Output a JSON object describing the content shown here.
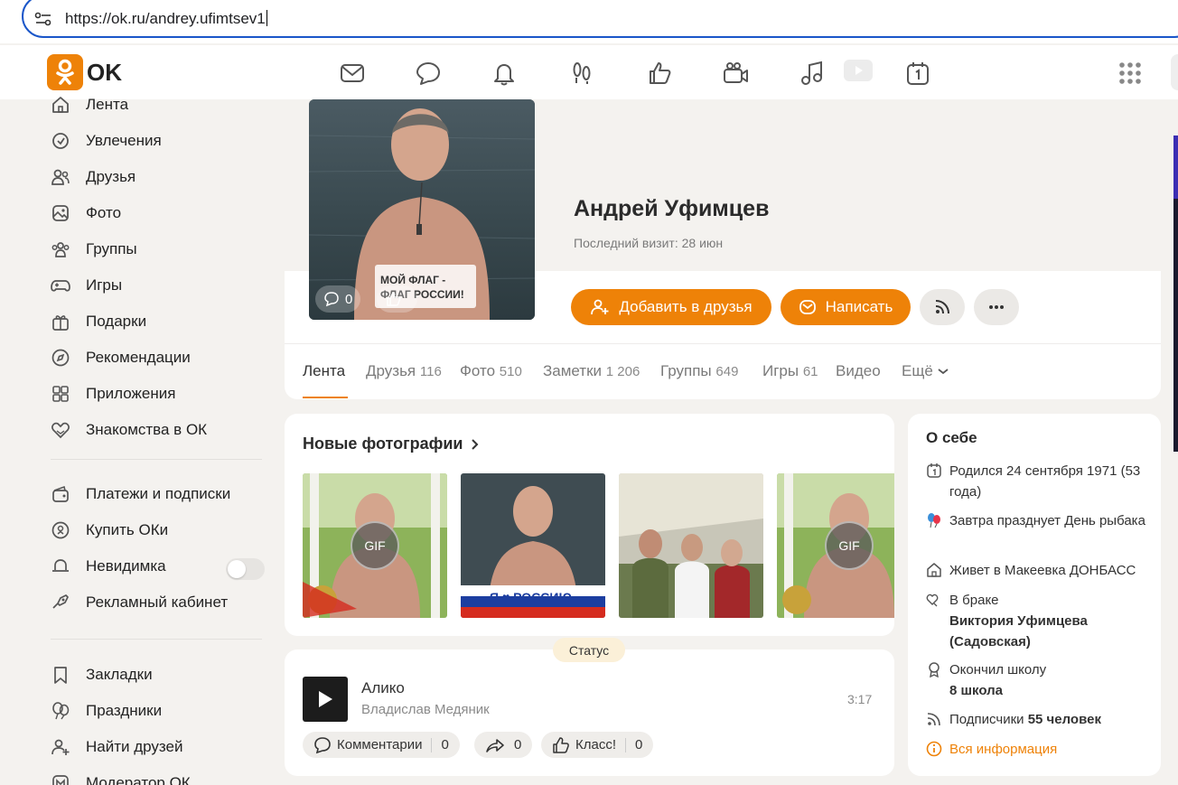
{
  "browser": {
    "url": "https://ok.ru/andrey.ufimtsev1"
  },
  "brand": {
    "logo_text": "OK",
    "accent": "#ee8208"
  },
  "topnav": {
    "icons": [
      "messages-icon",
      "discussions-icon",
      "notifications-icon",
      "guests-icon",
      "likes-icon",
      "friends-video-icon",
      "music-icon",
      "video-icon",
      "events-icon",
      "apps-grid-icon"
    ]
  },
  "sidebar": {
    "items": [
      {
        "label": "Лента",
        "icon": "home-icon"
      },
      {
        "label": "Увлечения",
        "icon": "hobby-icon"
      },
      {
        "label": "Друзья",
        "icon": "friends-icon"
      },
      {
        "label": "Фото",
        "icon": "photo-icon"
      },
      {
        "label": "Группы",
        "icon": "groups-icon"
      },
      {
        "label": "Игры",
        "icon": "gamepad-icon"
      },
      {
        "label": "Подарки",
        "icon": "gift-icon"
      },
      {
        "label": "Рекомендации",
        "icon": "compass-icon"
      },
      {
        "label": "Приложения",
        "icon": "apps-icon"
      },
      {
        "label": "Знакомства в ОК",
        "icon": "dating-icon"
      }
    ],
    "items2": [
      {
        "label": "Платежи и подписки",
        "icon": "wallet-icon"
      },
      {
        "label": "Купить ОКи",
        "icon": "coin-icon"
      },
      {
        "label": "Невидимка",
        "icon": "invisible-icon"
      },
      {
        "label": "Рекламный кабинет",
        "icon": "megaphone-icon"
      }
    ],
    "items3": [
      {
        "label": "Закладки",
        "icon": "bookmark-icon"
      },
      {
        "label": "Праздники",
        "icon": "balloons-icon"
      },
      {
        "label": "Найти друзей",
        "icon": "add-friend-icon"
      },
      {
        "label": "Модератор ОК",
        "icon": "moderator-icon"
      }
    ]
  },
  "profile": {
    "name": "Андрей Уфимцев",
    "last_visit": "Последний визит: 28 июн",
    "avatar_caption": "МОЙ ФЛАГ - ФЛАГ РОССИИ!",
    "avatar_comments": "0",
    "add_friend_label": "Добавить в друзья",
    "message_label": "Написать"
  },
  "tabs": [
    {
      "label": "Лента",
      "count": ""
    },
    {
      "label": "Друзья",
      "count": "116"
    },
    {
      "label": "Фото",
      "count": "510"
    },
    {
      "label": "Заметки",
      "count": "1 206"
    },
    {
      "label": "Группы",
      "count": "649"
    },
    {
      "label": "Игры",
      "count": "61"
    },
    {
      "label": "Видео",
      "count": ""
    },
    {
      "label": "Ещё",
      "count": ""
    }
  ],
  "photos": {
    "title": "Новые фотографии",
    "gif_label": "GIF",
    "flag_text": "Я ♥ РОССИЮ"
  },
  "status": {
    "tag": "Статус",
    "track_title": "Алико",
    "track_artist": "Владислав Медяник",
    "duration": "3:17",
    "comments_label": "Комментарии",
    "comments_count": "0",
    "shares_count": "0",
    "likes_label": "Класс!",
    "likes_count": "0"
  },
  "about": {
    "title": "О себе",
    "birthday": "Родился 24 сентября 1971 (53 года)",
    "holiday": "Завтра празднует День рыбака",
    "lives": "Живет в Макеевка ДОНБАСС",
    "marriage_prefix": "В браке",
    "spouse": "Виктория Уфимцева (Садовская)",
    "school_prefix": "Окончил школу",
    "school": "8 школа",
    "subscribers_prefix": "Подписчики",
    "subscribers": "55 человек",
    "all_info": "Вся информация"
  }
}
